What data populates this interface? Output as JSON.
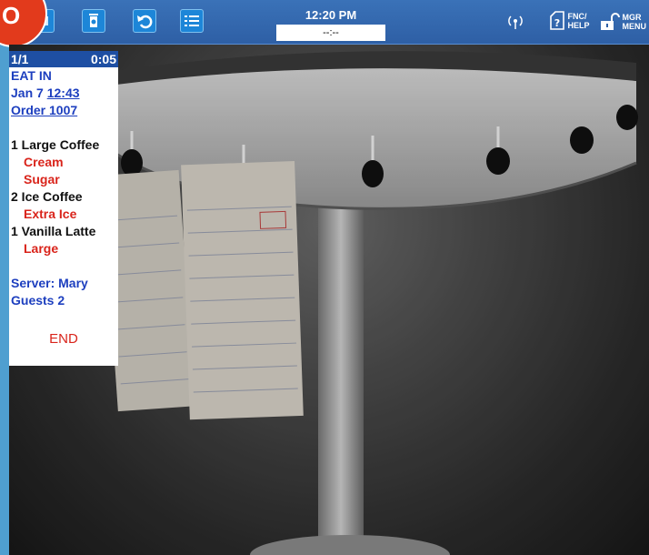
{
  "header": {
    "time": "12:20 PM",
    "time_field": "--:--",
    "fnc_help_label_1": "FNC/",
    "fnc_help_label_2": "HELP",
    "mgr_menu_label_1": "MGR",
    "mgr_menu_label_2": "MENU",
    "order_indicator": "O"
  },
  "ticket": {
    "page": "1/1",
    "timer": "0:05",
    "order_type": "EAT IN",
    "date": "Jan 7",
    "time": "12:43",
    "order_number": "Order 1007",
    "items": [
      {
        "qty_name": "1 Large Coffee",
        "mods": [
          "Cream",
          "Sugar"
        ]
      },
      {
        "qty_name": "2 Ice Coffee",
        "mods": [
          "Extra Ice"
        ]
      },
      {
        "qty_name": "1 Vanilla Latte",
        "mods": [
          "Large"
        ]
      }
    ],
    "server": "Server: Mary",
    "guests": "Guests 2",
    "end_label": "END"
  },
  "colors": {
    "toolbar": "#3a72b8",
    "ticket_header": "#1e4fa3",
    "ticket_blue": "#1d3fbf",
    "ticket_red": "#d9241b",
    "accent_circle": "#e23a1c"
  }
}
